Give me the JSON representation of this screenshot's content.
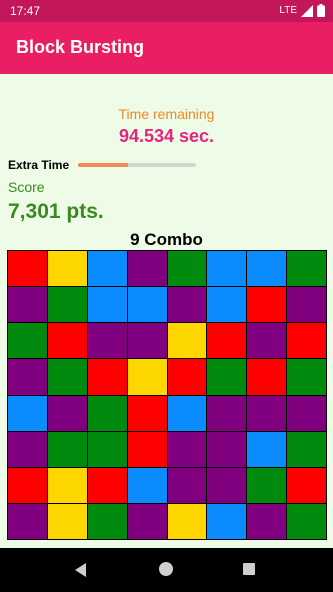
{
  "status": {
    "time": "17:47",
    "network": "LTE"
  },
  "app": {
    "title": "Block Bursting"
  },
  "game": {
    "time_label": "Time remaining",
    "time_value": "94.534 sec.",
    "extra_time_label": "Extra Time",
    "extra_time_progress": 0.42,
    "score_label": "Score",
    "score_value": "7,301 pts.",
    "combo": "9 Combo"
  },
  "colors": {
    "red": "#ff0000",
    "yellow": "#ffd700",
    "blue": "#0a8cff",
    "purple": "#800080",
    "green": "#008a0e",
    "app_bar": "#e91e63",
    "status_bar": "#c2185b",
    "background": "#eefbe6"
  },
  "board": [
    [
      "red",
      "yellow",
      "blue",
      "purple",
      "green",
      "blue",
      "blue",
      "green"
    ],
    [
      "purple",
      "green",
      "blue",
      "blue",
      "purple",
      "blue",
      "red",
      "purple"
    ],
    [
      "green",
      "red",
      "purple",
      "purple",
      "yellow",
      "red",
      "purple",
      "red"
    ],
    [
      "purple",
      "green",
      "red",
      "yellow",
      "red",
      "green",
      "red",
      "green"
    ],
    [
      "blue",
      "purple",
      "green",
      "red",
      "blue",
      "purple",
      "purple",
      "purple"
    ],
    [
      "purple",
      "green",
      "green",
      "red",
      "purple",
      "purple",
      "blue",
      "green"
    ],
    [
      "red",
      "yellow",
      "red",
      "blue",
      "purple",
      "purple",
      "green",
      "red"
    ],
    [
      "purple",
      "yellow",
      "green",
      "purple",
      "yellow",
      "blue",
      "purple",
      "green"
    ]
  ],
  "icons": [
    "signal-icon",
    "battery-icon",
    "back-icon",
    "home-icon",
    "recents-icon"
  ]
}
